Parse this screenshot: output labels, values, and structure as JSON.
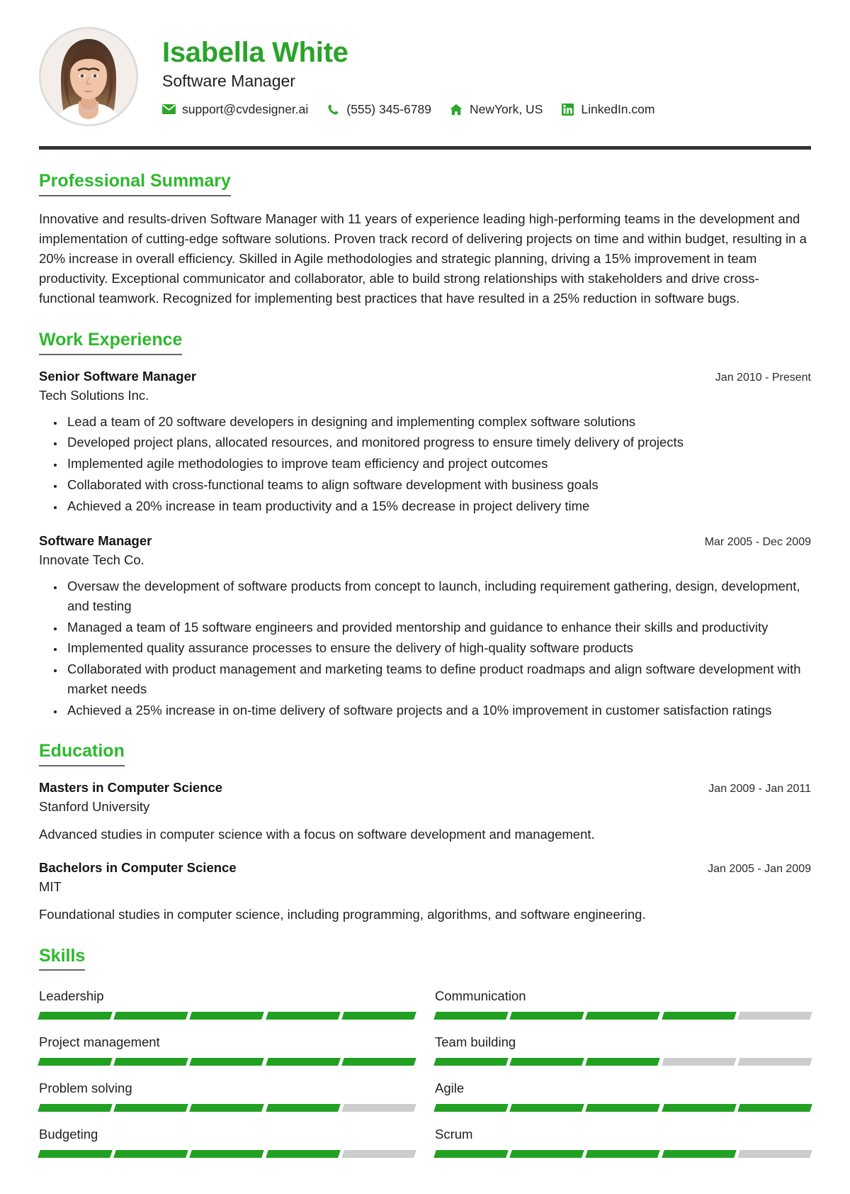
{
  "theme": {
    "accent": "#2eb82e",
    "name_color": "#29a329",
    "bar_on": "#22a022",
    "bar_off": "#cccccc",
    "rule": "#333333"
  },
  "header": {
    "name": "Isabella White",
    "job_title": "Software Manager",
    "contacts": [
      {
        "icon": "envelope-icon",
        "text": "support@cvdesigner.ai"
      },
      {
        "icon": "phone-icon",
        "text": "(555) 345-6789"
      },
      {
        "icon": "home-icon",
        "text": "NewYork, US"
      },
      {
        "icon": "linkedin-icon",
        "text": "LinkedIn.com"
      }
    ]
  },
  "summary": {
    "heading": "Professional Summary",
    "text": "Innovative and results-driven Software Manager with 11 years of experience leading high-performing teams in the development and implementation of cutting-edge software solutions. Proven track record of delivering projects on time and within budget, resulting in a 20% increase in overall efficiency. Skilled in Agile methodologies and strategic planning, driving a 15% improvement in team productivity. Exceptional communicator and collaborator, able to build strong relationships with stakeholders and drive cross-functional teamwork. Recognized for implementing best practices that have resulted in a 25% reduction in software bugs."
  },
  "work": {
    "heading": "Work Experience",
    "entries": [
      {
        "title": "Senior Software Manager",
        "company": "Tech Solutions Inc.",
        "date": "Jan 2010 - Present",
        "bullets": [
          "Lead a team of 20 software developers in designing and implementing complex software solutions",
          "Developed project plans, allocated resources, and monitored progress to ensure timely delivery of projects",
          "Implemented agile methodologies to improve team efficiency and project outcomes",
          "Collaborated with cross-functional teams to align software development with business goals",
          "Achieved a 20% increase in team productivity and a 15% decrease in project delivery time"
        ]
      },
      {
        "title": "Software Manager",
        "company": "Innovate Tech Co.",
        "date": "Mar 2005 - Dec 2009",
        "bullets": [
          "Oversaw the development of software products from concept to launch, including requirement gathering, design, development, and testing",
          "Managed a team of 15 software engineers and provided mentorship and guidance to enhance their skills and productivity",
          "Implemented quality assurance processes to ensure the delivery of high-quality software products",
          "Collaborated with product management and marketing teams to define product roadmaps and align software development with market needs",
          "Achieved a 25% increase in on-time delivery of software projects and a 10% improvement in customer satisfaction ratings"
        ]
      }
    ]
  },
  "education": {
    "heading": "Education",
    "entries": [
      {
        "degree": "Masters in Computer Science",
        "school": "Stanford University",
        "date": "Jan 2009 - Jan 2011",
        "description": "Advanced studies in computer science with a focus on software development and management."
      },
      {
        "degree": "Bachelors in Computer Science",
        "school": "MIT",
        "date": "Jan 2005 - Jan 2009",
        "description": "Foundational studies in computer science, including programming, algorithms, and software engineering."
      }
    ]
  },
  "skills": {
    "heading": "Skills",
    "max_level": 5,
    "items": [
      {
        "name": "Leadership",
        "level": 5
      },
      {
        "name": "Communication",
        "level": 4
      },
      {
        "name": "Project management",
        "level": 5
      },
      {
        "name": "Team building",
        "level": 3
      },
      {
        "name": "Problem solving",
        "level": 4
      },
      {
        "name": "Agile",
        "level": 5
      },
      {
        "name": "Budgeting",
        "level": 4
      },
      {
        "name": "Scrum",
        "level": 4
      }
    ]
  }
}
